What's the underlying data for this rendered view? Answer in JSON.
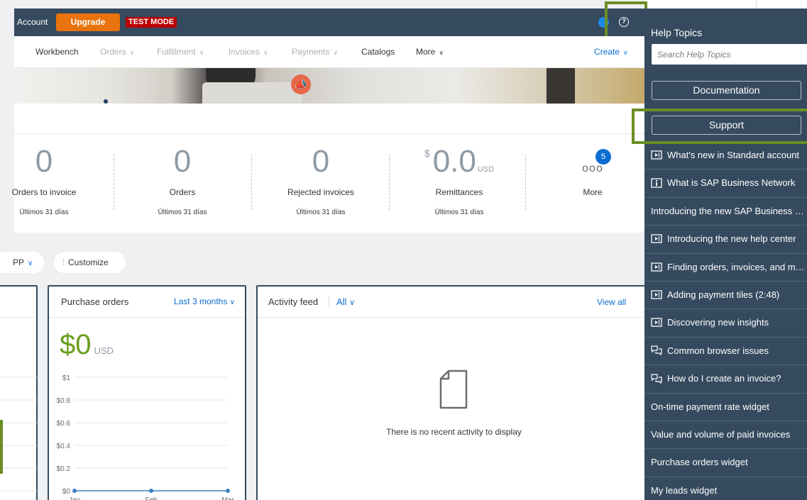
{
  "topbar": {
    "account_label": "Account",
    "upgrade_label": "Upgrade",
    "test_mode_label": "TEST MODE",
    "help_icon": "?"
  },
  "nav": {
    "items": [
      {
        "label": "Workbench",
        "enabled": true,
        "dropdown": false
      },
      {
        "label": "Orders",
        "enabled": false,
        "dropdown": true
      },
      {
        "label": "Fulfillment",
        "enabled": false,
        "dropdown": true
      },
      {
        "label": "Invoices",
        "enabled": false,
        "dropdown": true
      },
      {
        "label": "Payments",
        "enabled": false,
        "dropdown": true
      },
      {
        "label": "Catalogs",
        "enabled": true,
        "dropdown": false
      },
      {
        "label": "More",
        "enabled": true,
        "dropdown": true
      }
    ],
    "create_label": "Create"
  },
  "tiles": [
    {
      "value": "0",
      "label": "Orders to invoice",
      "period": "Últimos 31 días"
    },
    {
      "value": "0",
      "label": "Orders",
      "period": "Últimos 31 días"
    },
    {
      "value": "0",
      "label": "Rejected invoices",
      "period": "Últimos 31 días"
    },
    {
      "currency_symbol": "$",
      "value": "0.0",
      "unit": "USD",
      "label": "Remittances",
      "period": "Últimos 31 días"
    },
    {
      "value": "ooo",
      "badge": "5",
      "label": "More"
    }
  ],
  "controls": {
    "app_selector": "PP",
    "customize_label": "Customize"
  },
  "purchase_orders": {
    "title": "Purchase orders",
    "range_label": "Last 3 months",
    "amount": "$0",
    "currency": "USD"
  },
  "chart_data": {
    "type": "line",
    "categories": [
      "Jan",
      "Feb",
      "Mar"
    ],
    "values": [
      0,
      0,
      0
    ],
    "y_ticks": [
      "$0",
      "$0.2",
      "$0.4",
      "$0.6",
      "$0.8",
      "$1"
    ],
    "ylim": [
      0,
      1
    ],
    "grid": true,
    "color": "#3b7ec2"
  },
  "activity": {
    "title": "Activity feed",
    "filter_label": "All",
    "view_all_label": "View all",
    "empty_message": "There is no recent activity to display"
  },
  "help": {
    "title": "Help Topics",
    "search_placeholder": "Search Help Topics",
    "documentation_label": "Documentation",
    "support_label": "Support",
    "topics": [
      {
        "label": "What's new in Standard account",
        "icon": "video-icon"
      },
      {
        "label": "What is SAP Business Network",
        "icon": "info-icon"
      },
      {
        "label": "Introducing the new SAP Business Network",
        "icon": ""
      },
      {
        "label": "Introducing the new help center",
        "icon": "video-icon"
      },
      {
        "label": "Finding orders, invoices, and more",
        "icon": "video-icon"
      },
      {
        "label": "Adding payment tiles (2:48)",
        "icon": "video-icon"
      },
      {
        "label": "Discovering new insights",
        "icon": "video-icon"
      },
      {
        "label": "Common browser issues",
        "icon": "chat-icon"
      },
      {
        "label": "How do I create an invoice?",
        "icon": "chat-icon"
      },
      {
        "label": "On-time payment rate widget",
        "icon": ""
      },
      {
        "label": "Value and volume of paid invoices",
        "icon": ""
      },
      {
        "label": "Purchase orders widget",
        "icon": ""
      },
      {
        "label": "My leads widget",
        "icon": ""
      }
    ]
  },
  "colors": {
    "shell": "#354a5f",
    "accent": "#0a6ed1",
    "upgrade": "#e9730c",
    "test_mode": "#bb0000",
    "highlight": "#6a8e23",
    "amount_green": "#6a9e1f"
  }
}
